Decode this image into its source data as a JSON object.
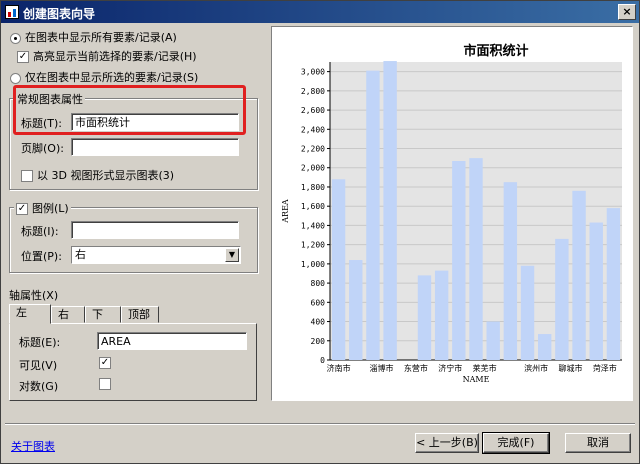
{
  "window": {
    "title": "创建图表向导",
    "close_glyph": "×"
  },
  "display_options": {
    "show_all": "在图表中显示所有要素/记录(A)",
    "highlight_selected": "高亮显示当前选择的要素/记录(H)",
    "show_selected_only": "仅在图表中显示所选的要素/记录(S)"
  },
  "general": {
    "legend": "常规图表属性",
    "title_label": "标题(T):",
    "title_value": "市面积统计",
    "footer_label": "页脚(O):",
    "footer_value": "",
    "view3d_label": "以 3D 视图形式显示图表(3)"
  },
  "legend_group": {
    "legend": "图例(L)",
    "title_label": "标题(I):",
    "title_value": "",
    "position_label": "位置(P):",
    "position_value": "右"
  },
  "axis": {
    "legend": "轴属性(X)",
    "tabs": [
      "左",
      "右",
      "下",
      "顶部"
    ],
    "title_label": "标题(E):",
    "title_value": "AREA",
    "visible_label": "可见(V)",
    "log_label": "对数(G)"
  },
  "footer": {
    "about_link": "关于图表",
    "back_button": "< 上一步(B)",
    "finish_button": "完成(F)",
    "cancel_button": "取消"
  },
  "colors": {
    "bar": "#c0d4f8",
    "plot_bg": "#e4e4e4",
    "highlight_box": "#e02020"
  },
  "chart_data": {
    "type": "bar",
    "title": "市面积统计",
    "xlabel": "NAME",
    "ylabel": "AREA",
    "ylim": [
      0,
      3100
    ],
    "yticks": [
      0,
      200,
      400,
      600,
      800,
      1000,
      1200,
      1400,
      1600,
      1800,
      2000,
      2200,
      2400,
      2600,
      2800,
      3000
    ],
    "ytick_labels": [
      "0",
      "200",
      "400",
      "600",
      "800",
      "1,000",
      "1,200",
      "1,400",
      "1,600",
      "1,800",
      "2,000",
      "2,200",
      "2,400",
      "2,600",
      "2,800",
      "3,000"
    ],
    "grid": true,
    "category_labels": [
      {
        "label": "济南市",
        "index": 0
      },
      {
        "label": "淄博市",
        "index": 2.5
      },
      {
        "label": "东营市",
        "index": 4.5
      },
      {
        "label": "济宁市",
        "index": 6.5
      },
      {
        "label": "莱芜市",
        "index": 8.5
      },
      {
        "label": "滨州市",
        "index": 11.5
      },
      {
        "label": "聊城市",
        "index": 13.5
      },
      {
        "label": "菏泽市",
        "index": 15.5
      }
    ],
    "values": [
      1880,
      1040,
      3010,
      3110,
      0,
      880,
      930,
      2070,
      2100,
      400,
      1850,
      980,
      270,
      1260,
      1760,
      1430,
      1580
    ]
  }
}
